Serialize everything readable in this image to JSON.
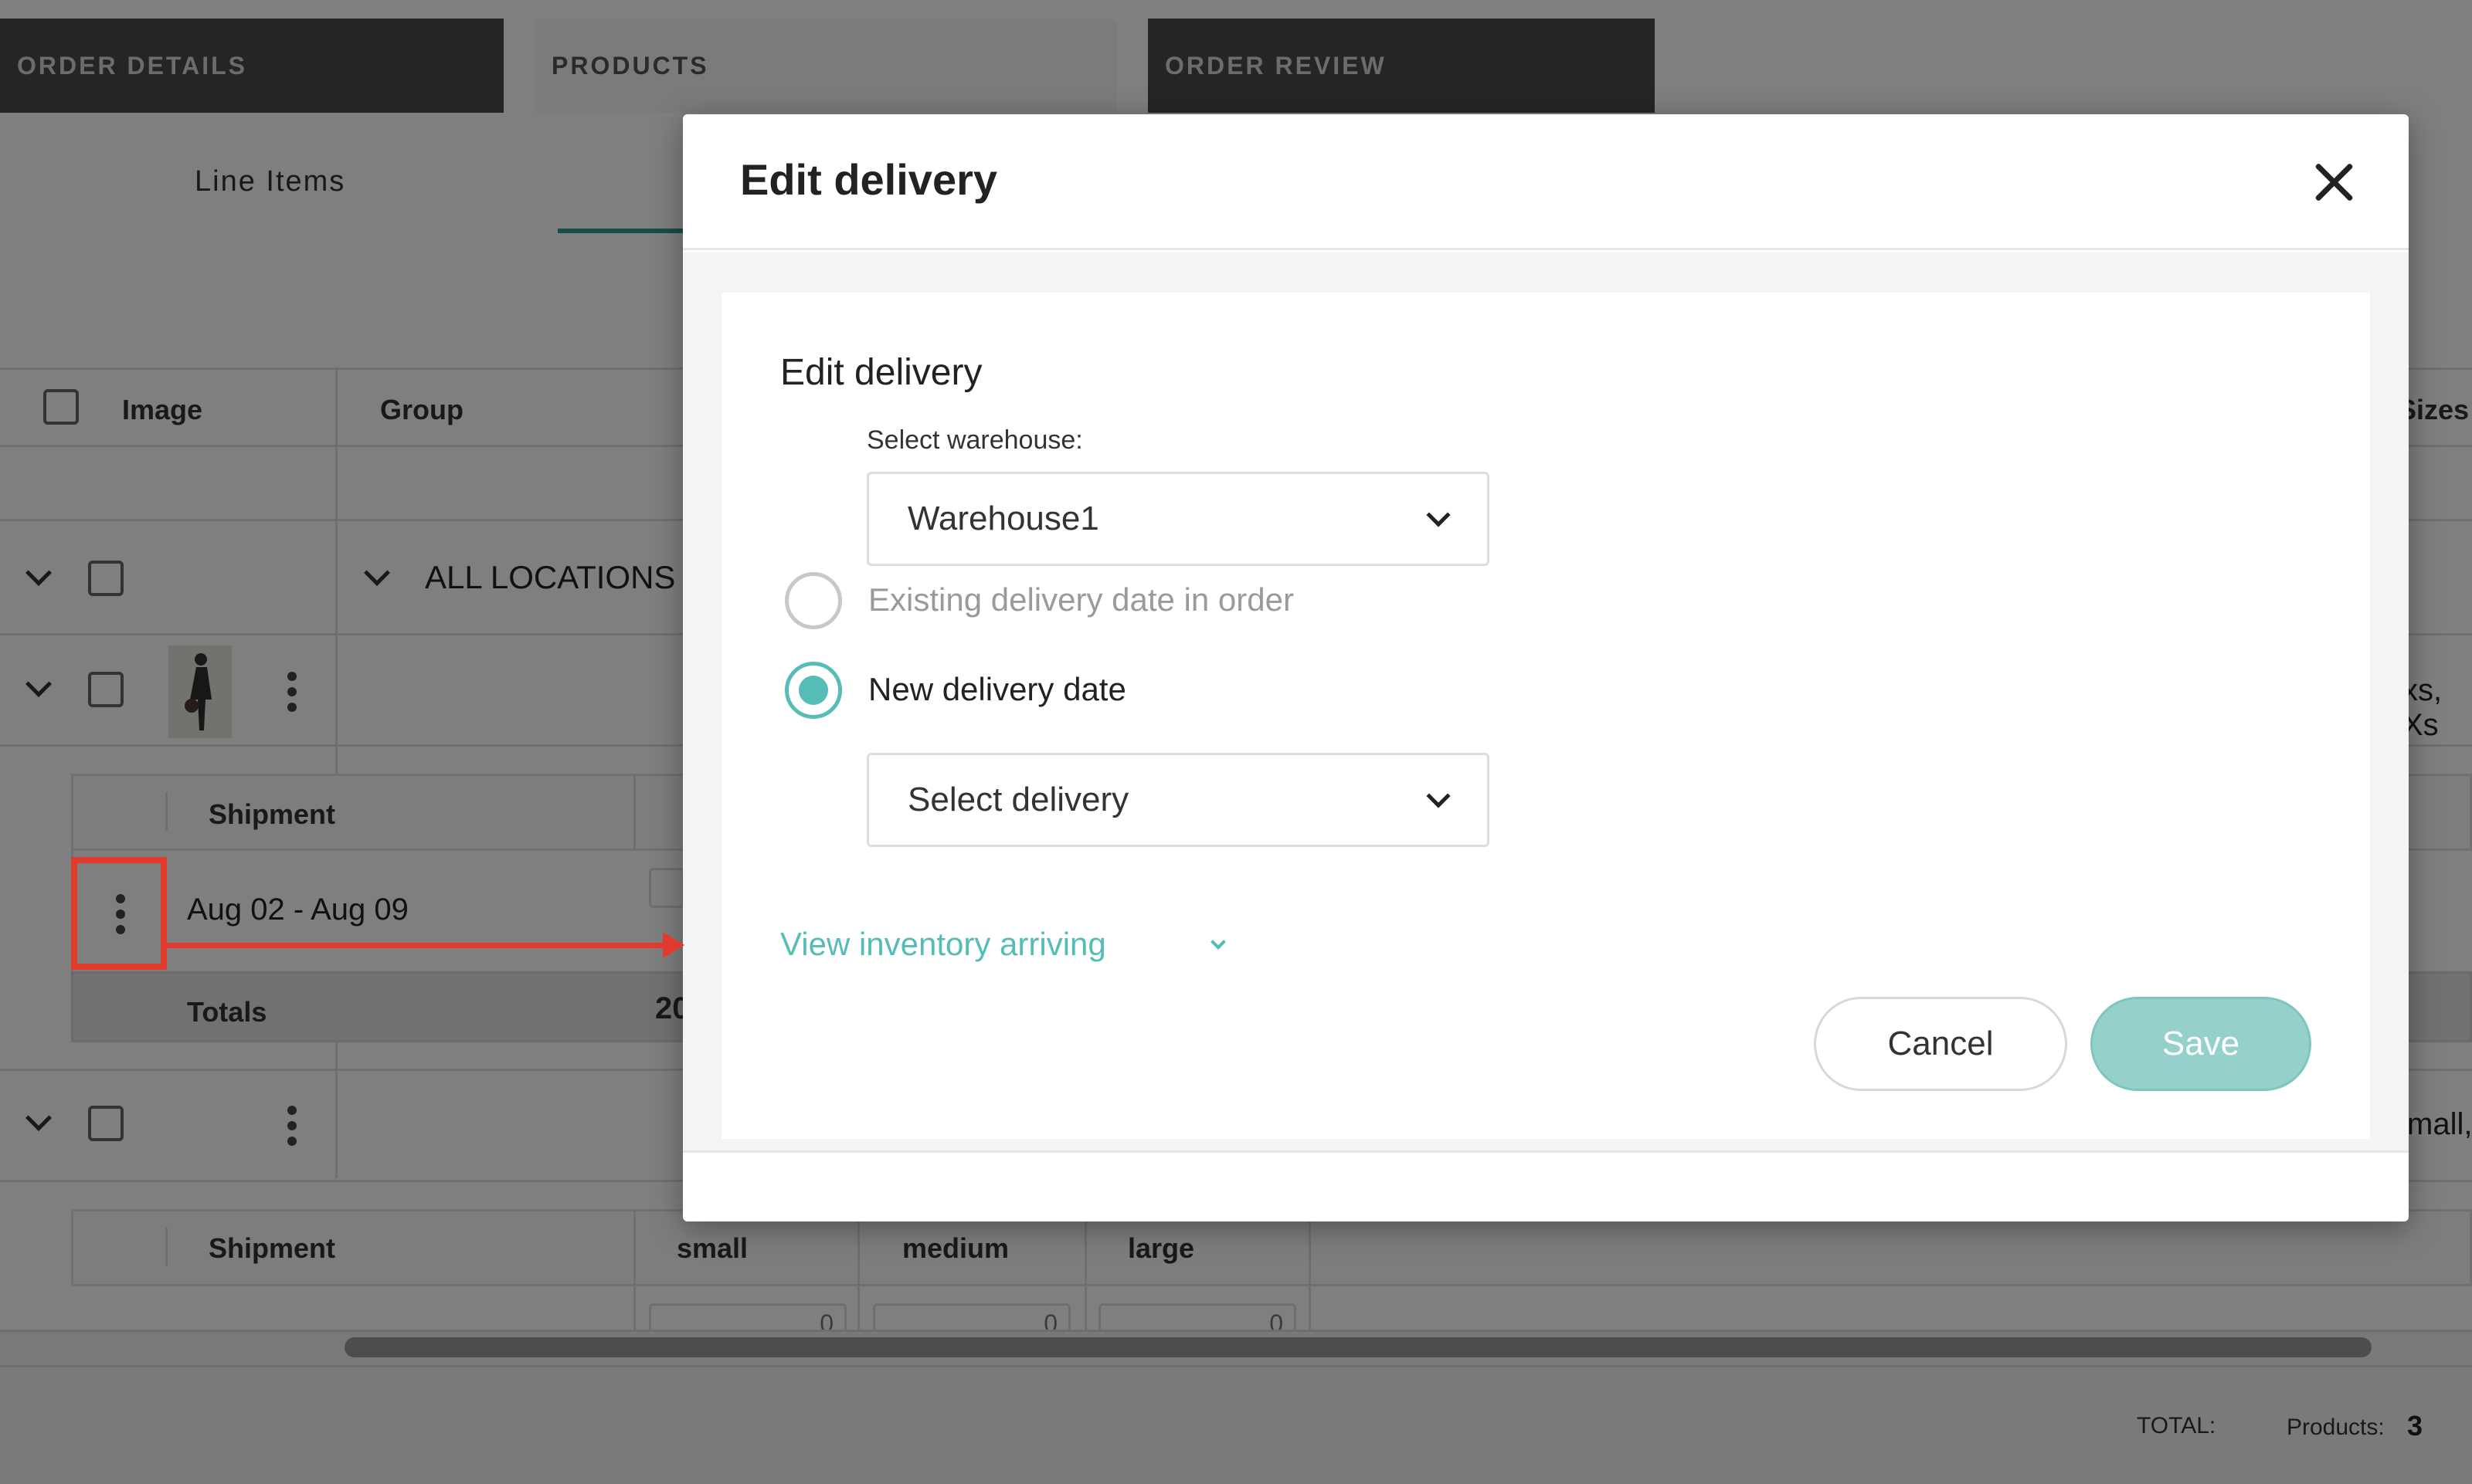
{
  "tabs": [
    {
      "label": "ORDER DETAILS",
      "active": false
    },
    {
      "label": "PRODUCTS",
      "active": true
    },
    {
      "label": "ORDER REVIEW",
      "active": false
    }
  ],
  "sub_tabs": {
    "line_items": "Line Items"
  },
  "table": {
    "headers": {
      "image": "Image",
      "group": "Group",
      "sizes": "Sizes"
    },
    "group_row": {
      "label": "ALL LOCATIONS"
    },
    "row1_sizes_snippet": "xs, Xs",
    "row2_sizes_snippet": "mall,",
    "shipment_header": "Shipment",
    "shipment_row": {
      "date_range": "Aug 02 - Aug 09"
    },
    "totals": {
      "label": "Totals",
      "value_snippet": "20"
    },
    "shipment2": {
      "header": "Shipment",
      "sizes": [
        "small",
        "medium",
        "large"
      ],
      "values": [
        "0",
        "0",
        "0"
      ]
    }
  },
  "footer": {
    "total_label": "TOTAL:",
    "products_label": "Products:",
    "products_count": "3"
  },
  "dialog": {
    "title": "Edit delivery",
    "section_title": "Edit delivery",
    "warehouse_label": "Select warehouse:",
    "warehouse_value": "Warehouse1",
    "option_existing": "Existing delivery date in order",
    "option_new": "New delivery date",
    "selected_option": "new",
    "delivery_placeholder": "Select delivery",
    "inventory_link": "View inventory arriving",
    "cancel_label": "Cancel",
    "save_label": "Save"
  },
  "colors": {
    "accent": "#55bdb5",
    "annotation": "#e23a2e",
    "save_button": "#95d0cb"
  }
}
